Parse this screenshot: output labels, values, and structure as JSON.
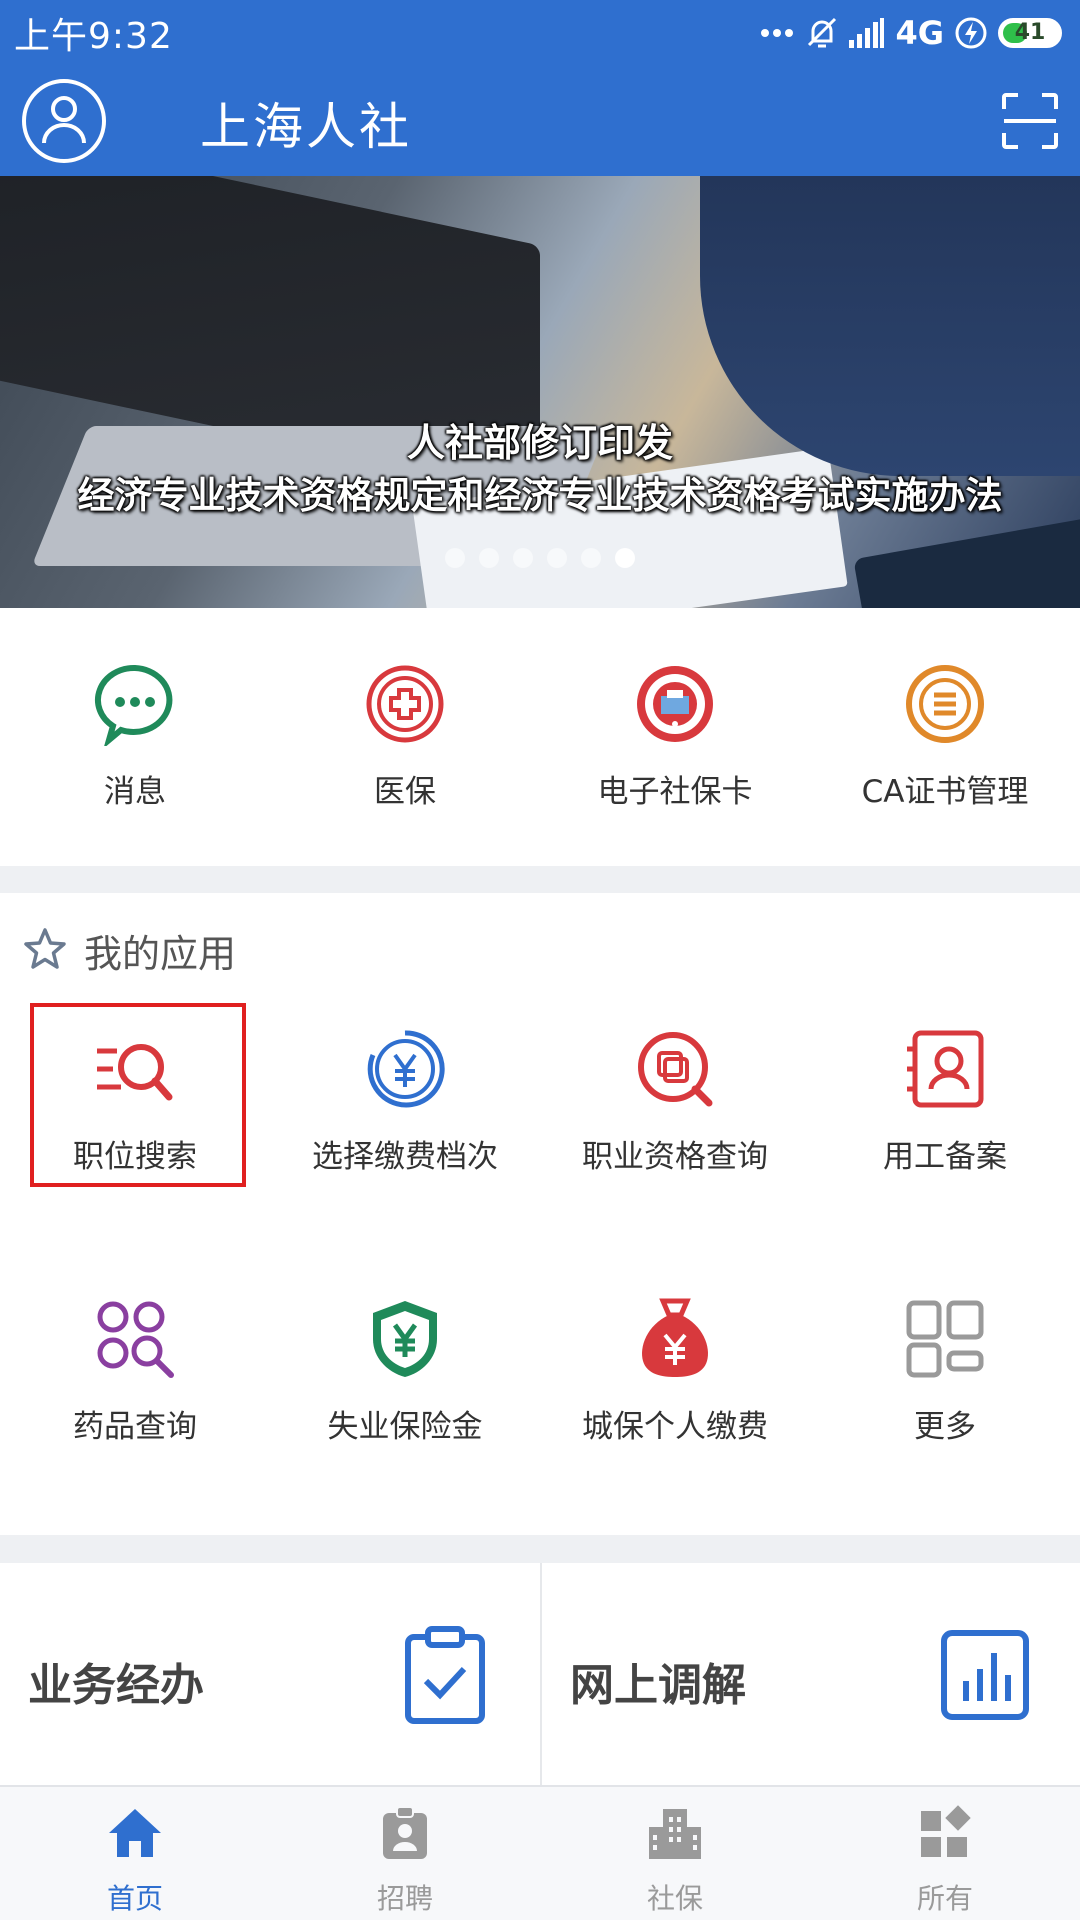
{
  "status_bar": {
    "time": "上午9:32",
    "network": "4G",
    "battery": "41"
  },
  "header": {
    "title": "上海人社"
  },
  "banner": {
    "caption_line1": "人社部修订印发",
    "caption_line2": "经济专业技术资格规定和经济专业技术资格考试实施办法",
    "slide_count": 6,
    "active_slide": 6
  },
  "quick_services": [
    {
      "label": "消息",
      "icon": "chat-icon",
      "color": "#1f8a5a"
    },
    {
      "label": "医保",
      "icon": "medical-cross-icon",
      "color": "#d8393d"
    },
    {
      "label": "电子社保卡",
      "icon": "social-security-card-icon",
      "color": "#d8393d"
    },
    {
      "label": "CA证书管理",
      "icon": "list-circle-icon",
      "color": "#e0892a"
    }
  ],
  "my_apps": {
    "title": "我的应用",
    "rows": [
      [
        {
          "label": "职位搜索",
          "icon": "job-search-icon",
          "color": "#d8393d",
          "highlighted": true
        },
        {
          "label": "选择缴费档次",
          "icon": "yuan-circle-icon",
          "color": "#2f6fcf"
        },
        {
          "label": "职业资格查询",
          "icon": "certificate-search-icon",
          "color": "#d8393d"
        },
        {
          "label": "用工备案",
          "icon": "employment-record-icon",
          "color": "#d8393d"
        }
      ],
      [
        {
          "label": "药品查询",
          "icon": "drug-search-icon",
          "color": "#8a3fa0"
        },
        {
          "label": "失业保险金",
          "icon": "yuan-shield-icon",
          "color": "#1f8a5a"
        },
        {
          "label": "城保个人缴费",
          "icon": "money-bag-icon",
          "color": "#d8393d"
        },
        {
          "label": "更多",
          "icon": "grid-more-icon",
          "color": "#9a9a9a"
        }
      ]
    ]
  },
  "cards": [
    {
      "title": "业务经办",
      "icon": "clipboard-check-icon",
      "color": "#2f6fcf"
    },
    {
      "title": "网上调解",
      "icon": "bar-chart-icon",
      "color": "#2f6fcf"
    }
  ],
  "tabs": [
    {
      "label": "首页",
      "icon": "home-icon",
      "active": true
    },
    {
      "label": "招聘",
      "icon": "badge-icon",
      "active": false
    },
    {
      "label": "社保",
      "icon": "building-icon",
      "active": false
    },
    {
      "label": "所有",
      "icon": "apps-icon",
      "active": false
    }
  ],
  "colors": {
    "primary": "#2f6fcf",
    "highlight_border": "#e02020",
    "tab_inactive": "#9a9a9a"
  }
}
